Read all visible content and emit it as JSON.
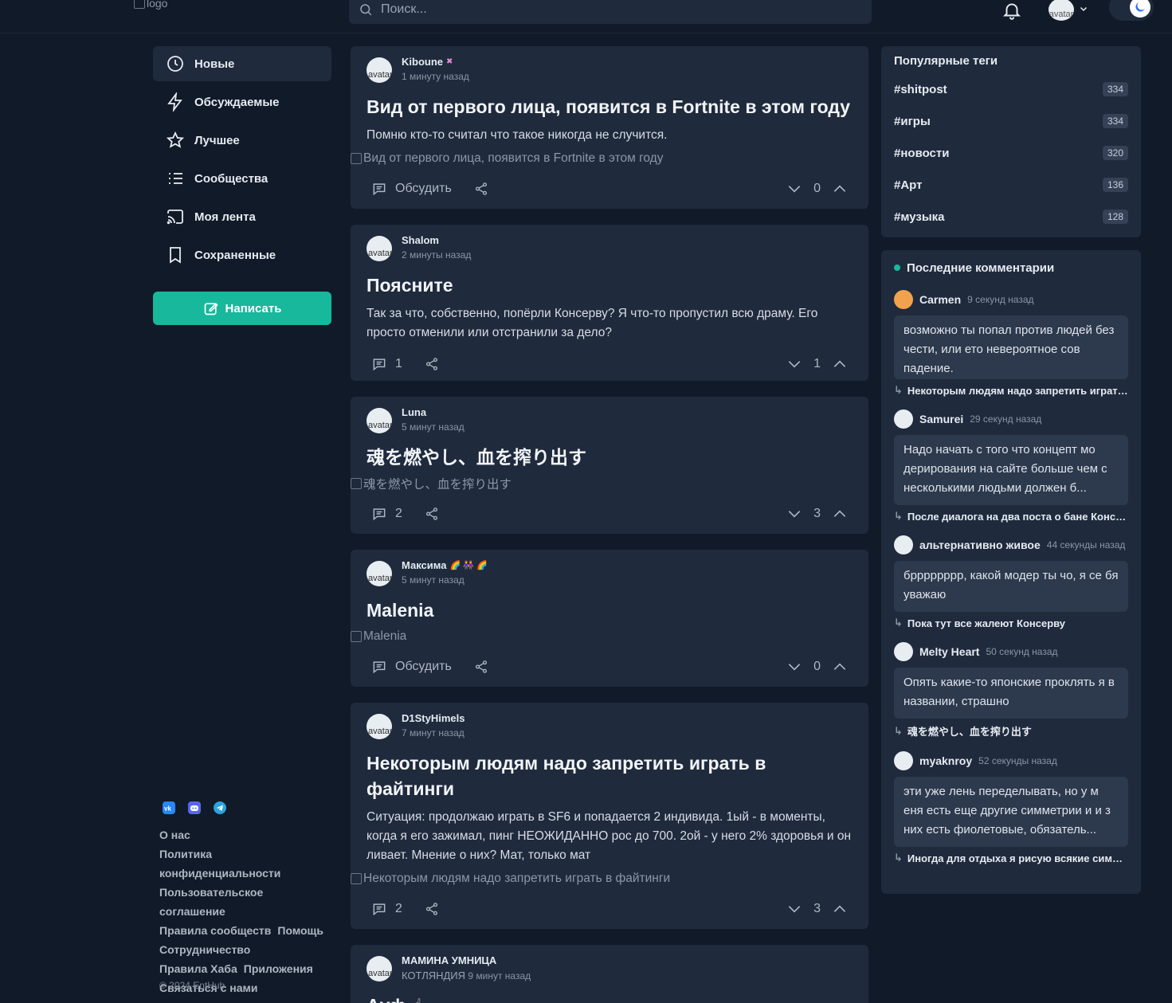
{
  "header": {
    "logo_alt": "logo",
    "search_placeholder": "Поиск...",
    "avatar_alt": "avatar"
  },
  "nav": {
    "items": [
      {
        "label": "Новые",
        "icon": "clock-icon"
      },
      {
        "label": "Обсуждаемые",
        "icon": "lightning-icon"
      },
      {
        "label": "Лучшее",
        "icon": "star-icon"
      },
      {
        "label": "Сообщества",
        "icon": "list-icon"
      },
      {
        "label": "Моя лента",
        "icon": "cast-icon"
      },
      {
        "label": "Сохраненные",
        "icon": "bookmark-icon"
      }
    ],
    "write_label": "Написать"
  },
  "footer": {
    "links": [
      "О нас",
      "Политика конфиденциальности",
      "Пользовательское соглашение",
      "Правила сообществ",
      "Помощь",
      "Сотрудничество",
      "Правила Хаба",
      "Приложения",
      "Связаться с нами"
    ],
    "copyright": "© 2024 EntHub"
  },
  "posts": [
    {
      "author": "Kiboune",
      "time": "1 минуту назад",
      "title": "Вид от первого лица, появится в Fortnite в этом году",
      "body": "Помню кто-то считал что такое никогда не случится.",
      "image_alt": "Вид от первого лица, появится в Fortnite в этом году",
      "comments": "Обсудить",
      "votes": "0"
    },
    {
      "author": "Shalom",
      "time": "2 минуты назад",
      "title": "Поясните",
      "body": "Так за что, собственно, попёрли Консерву? Я что-то пропустил всю драму. Его просто отменили или отстранили за дело?",
      "comments": "1",
      "votes": "1"
    },
    {
      "author": "Luna",
      "time": "5 минут назад",
      "title": "魂を燃やし、血を搾り出す",
      "image_alt": "魂を燃やし、血を搾り出す",
      "comments": "2",
      "votes": "3"
    },
    {
      "author": "Максима",
      "author_emoji": "🌈 👭 🌈",
      "time": "5 минут назад",
      "title": "Malenia",
      "image_alt": "Malenia",
      "comments": "Обсудить",
      "votes": "0"
    },
    {
      "author": "D1StyHimels",
      "time": "7 минут назад",
      "title": "Некоторым людям надо запретить играть в файтинги",
      "body": "Ситуация: продолжаю играть в SF6 и попадается 2 индивида. 1ый - в моменты, когда я его зажимал, пинг НЕОЖИДАННО рос до 700. 2ой - у него 2% здоровья и он ливает. Мнение о них? Мат, только мат",
      "image_alt": "Некоторым людям надо запретить играть в файтинги",
      "comments": "2",
      "votes": "3"
    },
    {
      "author": "МАМИНА УМНИЦА",
      "community": "КОТЛЯНДИЯ",
      "time": "9 минут назад",
      "title": "Ауф ☝"
    }
  ],
  "tags": {
    "title": "Популярные теги",
    "items": [
      {
        "name": "#shitpost",
        "count": "334"
      },
      {
        "name": "#игры",
        "count": "334"
      },
      {
        "name": "#новости",
        "count": "320"
      },
      {
        "name": "#Арт",
        "count": "136"
      },
      {
        "name": "#музыка",
        "count": "128"
      }
    ]
  },
  "recent_comments": {
    "title": "Последние комментарии",
    "items": [
      {
        "author": "Carmen",
        "time": "9 секунд назад",
        "text": "возможно ты попал против людей без чести, или ето невероятное сов падение.",
        "ref": "Некоторым людям надо запретить играть в файтинги"
      },
      {
        "author": "Samurei",
        "time": "29 секунд назад",
        "text": "Надо начать с того что концепт мо дерирования на сайте больше чем с несколькими людьми должен б...",
        "ref": "После диалога на два поста о бане Консервы"
      },
      {
        "author": "альтернативно живое",
        "time": "44 секунды назад",
        "text": "брррррррр, какой модер ты чо, я се бя уважаю",
        "ref": "Пока тут все жалеют Консерву"
      },
      {
        "author": "Melty Heart",
        "time": "50 секунд назад",
        "text": "Опять какие-то японские проклять я в названии, страшно",
        "ref": "魂を燃やし、血を搾り出す"
      },
      {
        "author": "myaknroy",
        "time": "52 секунды назад",
        "text": "эти уже лень переделывать, но у м еня есть еще другие симметрии и и з них есть фиолетовые, обязатель...",
        "ref": "Иногда для отдыха я рисую всякие симметрии"
      }
    ]
  },
  "colors": {
    "background": "#111a28",
    "card": "#1f2a3c",
    "accent": "#18b89c"
  }
}
